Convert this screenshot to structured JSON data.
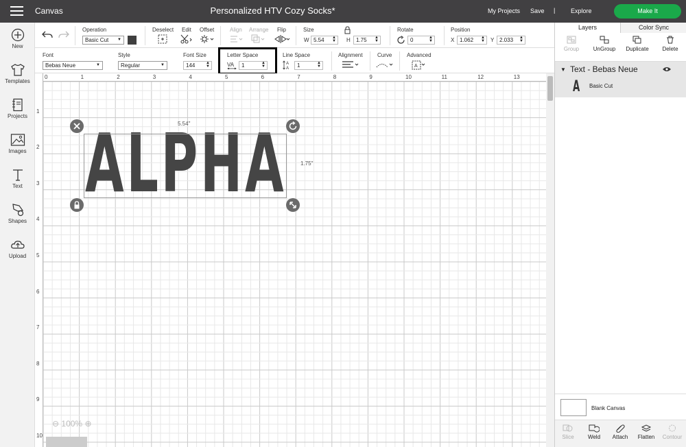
{
  "topbar": {
    "app_title": "Canvas",
    "project_title": "Personalized HTV Cozy Socks*",
    "my_projects": "My Projects",
    "save": "Save",
    "separator": "|",
    "explore": "Explore",
    "make_it": "Make It",
    "make_it_color": "#1aa94a"
  },
  "sidebar": {
    "items": [
      {
        "label": "New",
        "icon": "plus-circle-icon"
      },
      {
        "label": "Templates",
        "icon": "shirt-icon"
      },
      {
        "label": "Projects",
        "icon": "notebook-icon"
      },
      {
        "label": "Images",
        "icon": "image-icon"
      },
      {
        "label": "Text",
        "icon": "text-icon"
      },
      {
        "label": "Shapes",
        "icon": "shapes-icon"
      },
      {
        "label": "Upload",
        "icon": "upload-cloud-icon"
      }
    ]
  },
  "toolbar1": {
    "operation_label": "Operation",
    "operation_value": "Basic Cut",
    "deselect_label": "Deselect",
    "edit_label": "Edit",
    "offset_label": "Offset",
    "align_label": "Align",
    "arrange_label": "Arrange",
    "flip_label": "Flip",
    "size_label": "Size",
    "w_label": "W",
    "w_value": "5.54",
    "h_label": "H",
    "h_value": "1.75",
    "rotate_label": "Rotate",
    "rotate_value": "0",
    "position_label": "Position",
    "x_label": "X",
    "x_value": "1.062",
    "y_label": "Y",
    "y_value": "2.033"
  },
  "toolbar2": {
    "font_label": "Font",
    "font_value": "Bebas Neue",
    "style_label": "Style",
    "style_value": "Regular",
    "font_size_label": "Font Size",
    "font_size_value": "144",
    "letter_space_label": "Letter Space",
    "letter_space_value": "1",
    "line_space_label": "Line Space",
    "line_space_value": "1",
    "alignment_label": "Alignment",
    "curve_label": "Curve",
    "advanced_label": "Advanced"
  },
  "canvas": {
    "ruler_top": [
      "0",
      "1",
      "2",
      "3",
      "4",
      "5",
      "6",
      "7",
      "8",
      "9",
      "10",
      "11",
      "12",
      "13"
    ],
    "ruler_left": [
      "1",
      "2",
      "3",
      "4",
      "5",
      "6",
      "7",
      "8",
      "9",
      "10"
    ],
    "text": "ALPHA",
    "width_label": "5.54\"",
    "height_label": "1.75\"",
    "zoom": "100%"
  },
  "rpanel": {
    "tab_layers": "Layers",
    "tab_color_sync": "Color Sync",
    "actions": [
      {
        "label": "Group",
        "enabled": false
      },
      {
        "label": "UnGroup",
        "enabled": true
      },
      {
        "label": "Duplicate",
        "enabled": true
      },
      {
        "label": "Delete",
        "enabled": true
      }
    ],
    "layer_title": "Text - Bebas Neue",
    "layer_icon_glyph": "A",
    "layer_sub_label": "Basic Cut",
    "blank_canvas": "Blank Canvas",
    "bottom_actions": [
      {
        "label": "Slice",
        "enabled": false
      },
      {
        "label": "Weld",
        "enabled": true
      },
      {
        "label": "Attach",
        "enabled": true
      },
      {
        "label": "Flatten",
        "enabled": true
      },
      {
        "label": "Contour",
        "enabled": false
      }
    ]
  },
  "colors": {
    "topbar": "#414042",
    "text_fill": "#454545",
    "layer_highlight": "#e6e6e6",
    "operation_swatch": "#3f3f3f"
  }
}
